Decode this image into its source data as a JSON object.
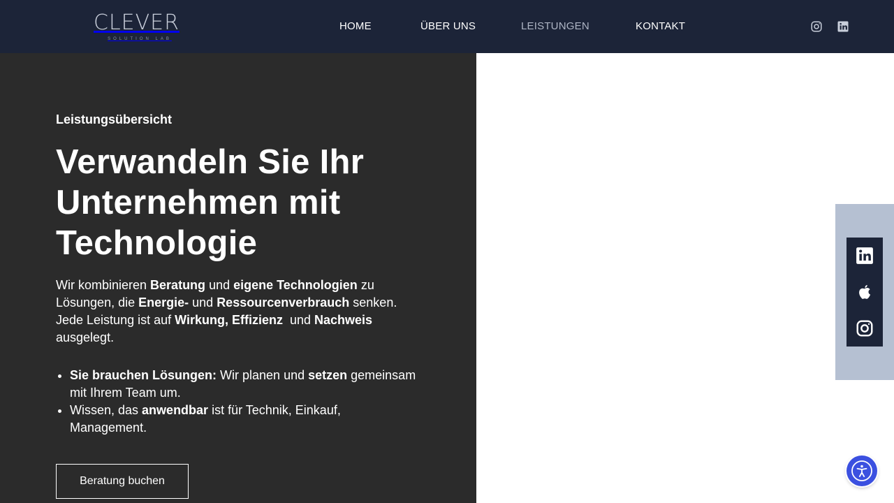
{
  "brand": {
    "name": "CLEVER",
    "tagline": "SOLUTION LAB"
  },
  "nav": {
    "home": "HOME",
    "about": "ÜBER UNS",
    "services": "LEISTUNGEN",
    "contact": "KONTAKT",
    "active": "LEISTUNGEN"
  },
  "header_icons": [
    "instagram-icon",
    "linkedin-icon"
  ],
  "hero": {
    "eyebrow": "Leistungsübersicht",
    "headline_line1": "Verwandeln Sie Ihr",
    "headline_line2": "Unternehmen mit",
    "headline_line3": "Technologie",
    "intro": {
      "t1": "Wir kombinieren ",
      "b1": "Beratung",
      "t2": " und ",
      "b2": "eigene Technologien",
      "t3": " zu Lösungen, die ",
      "b3": "Energie-",
      "t4": " und ",
      "b4": "Ressourcenverbrauch",
      "t5": " senken. Jede Leistung ist auf ",
      "b5": "Wirkung, Effizienz",
      "t6": "  und ",
      "b6": "Nachweis",
      "t7": " ausgelegt."
    },
    "bullet1": {
      "b1": "Sie brauchen Lösungen:",
      "t1": " Wir planen und ",
      "b2": "setzen",
      "t2": " gemeinsam mit Ihrem Team um."
    },
    "bullet2": {
      "t1": "Wissen, das ",
      "b1": "anwendbar",
      "t2": " ist für Technik, Einkauf, Management."
    },
    "cta_label": "Beratung buchen"
  },
  "social_sidebar": [
    "linkedin-icon",
    "apple-icon",
    "instagram-icon"
  ],
  "accessibility_icon": "accessibility-icon",
  "colors": {
    "header_bg": "#1c2438",
    "panel_bg": "#2b2b2b",
    "sidebar_band": "#b5c0d2",
    "accessibility_blue": "#3b50e0",
    "nav_active": "#aeb5c4"
  }
}
